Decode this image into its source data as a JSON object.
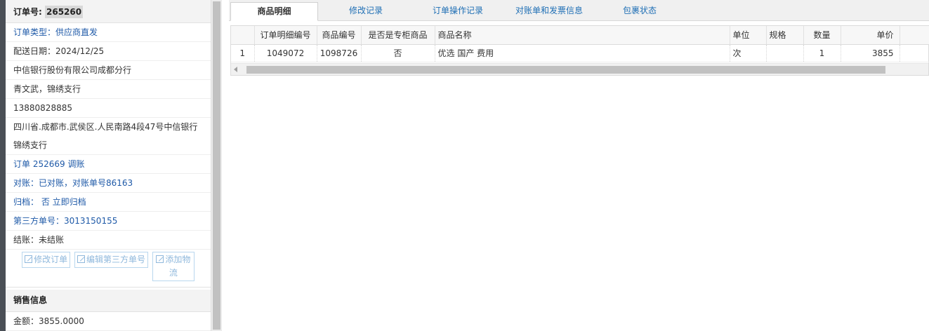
{
  "order": {
    "label": "订单号:",
    "number": "265260"
  },
  "info_rows": [
    {
      "text": "订单类型：供应商直发"
    },
    {
      "text": "配送日期：2024/12/25"
    },
    {
      "text": "中信银行股份有限公司成都分行"
    },
    {
      "text": "青文武，锦绣支行"
    },
    {
      "text": "13880828885"
    },
    {
      "text": "四川省.成都市.武侯区.人民南路4段47号中信银行锦绣支行"
    },
    {
      "text": "订单 252669 调账"
    },
    {
      "text": "对账：已对账，对账单号86163"
    },
    {
      "text": "归档： 否 立即归档"
    },
    {
      "text": "第三方单号：3013150155"
    },
    {
      "text": "结账：未结账"
    }
  ],
  "actions": {
    "edit_order": "修改订单",
    "edit_third": "编辑第三方单号",
    "add_logistics": "添加物流"
  },
  "sales": {
    "title": "销售信息",
    "amount": "金额：3855.0000"
  },
  "tabs": [
    {
      "label": "商品明细"
    },
    {
      "label": "修改记录"
    },
    {
      "label": "订单操作记录"
    },
    {
      "label": "对账单和发票信息"
    },
    {
      "label": "包裹状态"
    }
  ],
  "grid": {
    "headers": [
      "订单明细编号",
      "商品编号",
      "是否是专柜商品",
      "商品名称",
      "单位",
      "规格",
      "数量",
      "单价"
    ],
    "rows": [
      {
        "index": "1",
        "detail_id": "1049072",
        "product_id": "1098726",
        "counter": "否",
        "name": "优选 国产 费用",
        "unit": "次",
        "spec": "",
        "qty": "1",
        "price": "3855"
      }
    ]
  }
}
